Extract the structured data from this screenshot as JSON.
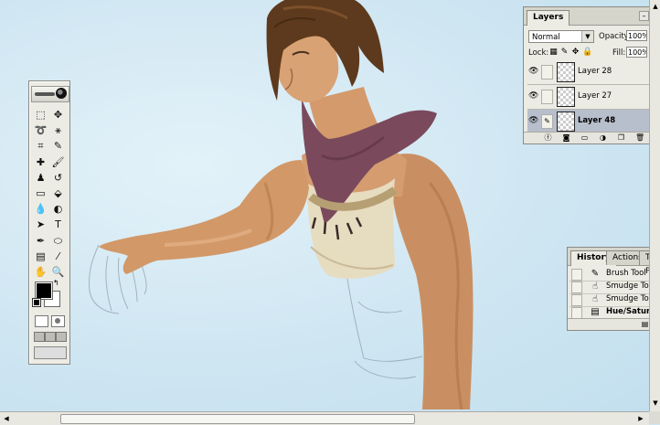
{
  "toolbox": {
    "tools": [
      {
        "name": "marquee-tool-icon",
        "glyph": "⬚"
      },
      {
        "name": "move-tool-icon",
        "glyph": "✥"
      },
      {
        "name": "lasso-tool-icon",
        "glyph": "➰"
      },
      {
        "name": "magic-wand-tool-icon",
        "glyph": "⚹"
      },
      {
        "name": "crop-tool-icon",
        "glyph": "⌗"
      },
      {
        "name": "slice-tool-icon",
        "glyph": "✎"
      },
      {
        "name": "healing-brush-tool-icon",
        "glyph": "✚"
      },
      {
        "name": "brush-tool-icon",
        "glyph": "🖌"
      },
      {
        "name": "clone-stamp-tool-icon",
        "glyph": "♟"
      },
      {
        "name": "history-brush-tool-icon",
        "glyph": "↺"
      },
      {
        "name": "eraser-tool-icon",
        "glyph": "▭"
      },
      {
        "name": "paint-bucket-tool-icon",
        "glyph": "⬙"
      },
      {
        "name": "blur-tool-icon",
        "glyph": "💧"
      },
      {
        "name": "dodge-tool-icon",
        "glyph": "◐"
      },
      {
        "name": "path-selection-tool-icon",
        "glyph": "➤"
      },
      {
        "name": "type-tool-icon",
        "glyph": "T"
      },
      {
        "name": "pen-tool-icon",
        "glyph": "✒"
      },
      {
        "name": "ellipse-tool-icon",
        "glyph": "⬭"
      },
      {
        "name": "notes-tool-icon",
        "glyph": "▤"
      },
      {
        "name": "eyedropper-tool-icon",
        "glyph": "⁄"
      },
      {
        "name": "hand-tool-icon",
        "glyph": "✋"
      },
      {
        "name": "zoom-tool-icon",
        "glyph": "🔍"
      }
    ],
    "foreground_color": "#000000",
    "background_color": "#ffffff"
  },
  "layers": {
    "tab_label": "Layers",
    "blend_mode": "Normal",
    "opacity_label": "Opacity:",
    "opacity_value": "100%",
    "lock_label": "Lock:",
    "fill_label": "Fill:",
    "fill_value": "100%",
    "items": [
      {
        "name": "Layer 28",
        "visible": true,
        "selected": false
      },
      {
        "name": "Layer 27",
        "visible": true,
        "selected": false
      },
      {
        "name": "Layer 48",
        "visible": true,
        "selected": true
      }
    ]
  },
  "history": {
    "tabs": [
      "History",
      "Actions",
      "Tool Pr"
    ],
    "items": [
      {
        "label": "Brush Tool",
        "bold": false
      },
      {
        "label": "Smudge Tool",
        "bold": false
      },
      {
        "label": "Smudge Tool",
        "bold": false
      },
      {
        "label": "Hue/Saturation",
        "bold": true
      }
    ]
  }
}
